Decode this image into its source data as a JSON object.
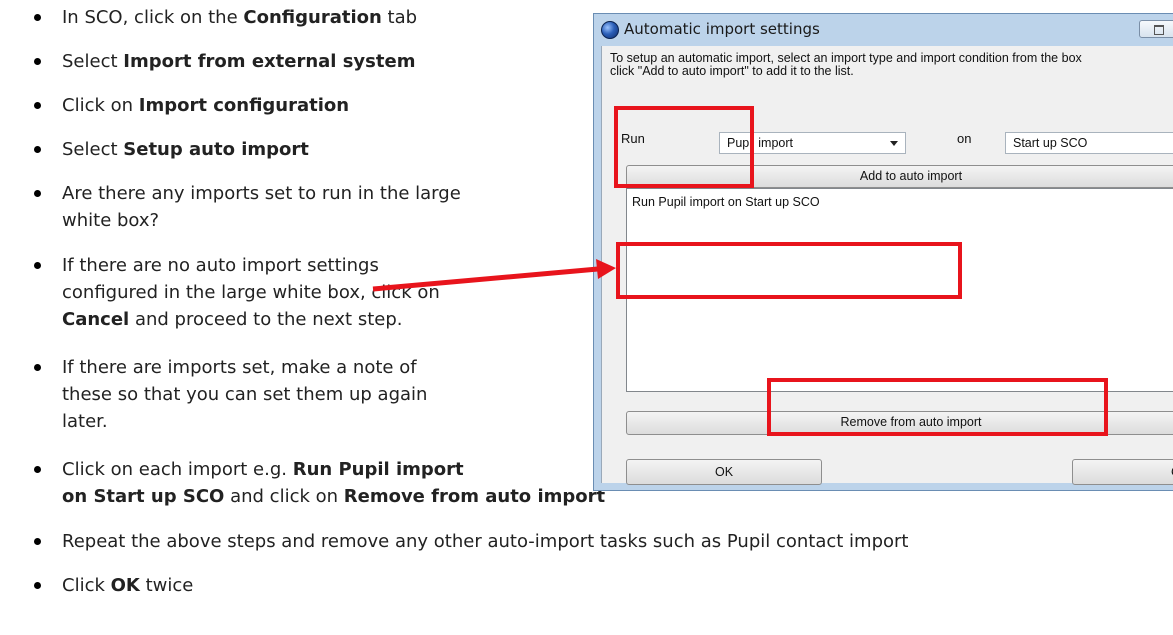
{
  "instructions": [
    {
      "before": "In SCO, click on the ",
      "bold": "Configuration",
      "after": " tab"
    },
    {
      "before": "Select ",
      "bold": "Import from external system",
      "after": ""
    },
    {
      "before": "Click on ",
      "bold": "Import configuration",
      "after": ""
    },
    {
      "before": "Select ",
      "bold": "Setup auto import",
      "after": ""
    },
    {
      "line1": "Are there any imports set to run in the large",
      "line2": "white box?"
    },
    {
      "line1": "If there are no auto import settings",
      "line2": "configured in the large white box, click on",
      "line3_bold": "Cancel",
      "line3_after": " and proceed to the next step."
    },
    {
      "line1": "If there are imports set, make a note of",
      "line2": "these so that you can set them up again",
      "line3": "later."
    },
    {
      "l1_before": "Click on each import e.g. ",
      "l1_bold": "Run Pupil import",
      "l2_bold1": "on Start up SCO",
      "l2_mid": " and click on ",
      "l2_bold2": "Remove from auto import"
    },
    {
      "text": "Repeat the above steps and remove any other auto-import tasks such as Pupil contact import"
    },
    {
      "before": "Click ",
      "bold": "OK",
      "after": " twice"
    }
  ],
  "dialog": {
    "title": "Automatic import settings",
    "description": "To setup an automatic import, select an import type and import condition from the box\nclick \"Add to auto import\" to add it to the list.",
    "run_label": "Run",
    "run_value": "Pupil import",
    "on_label": "on",
    "on_value": "Start up SCO",
    "add_button": "Add to auto import",
    "list_items": [
      "Run Pupil import on Start up SCO"
    ],
    "remove_button": "Remove from auto import",
    "ok_button": "OK",
    "cancel_button": "Ca"
  },
  "colors": {
    "highlight": "#e8141c",
    "dialog_frame": "#bcd3ea"
  }
}
